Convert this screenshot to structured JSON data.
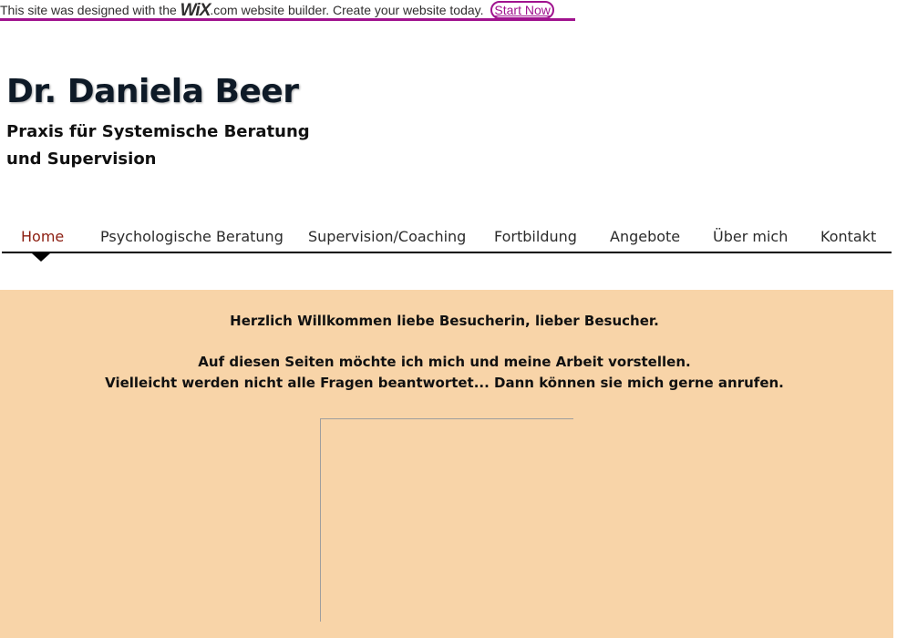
{
  "banner": {
    "prefix": "This site was designed with the",
    "logo": "WiX",
    "suffix": ".com website builder. Create your website today.",
    "cta": "Start Now",
    "accent": "#a0138e"
  },
  "site": {
    "title": "Dr. Daniela Beer",
    "subtitle_line1": "Praxis für Systemische Beratung",
    "subtitle_line2": "und Supervision"
  },
  "nav": {
    "items": [
      {
        "label": "Home",
        "active": true
      },
      {
        "label": "Psychologische Beratung",
        "active": false
      },
      {
        "label": "Supervision/Coaching",
        "active": false
      },
      {
        "label": "Fortbildung",
        "active": false
      },
      {
        "label": "Angebote",
        "active": false
      },
      {
        "label": "Über mich",
        "active": false
      },
      {
        "label": "Kontakt",
        "active": false
      }
    ],
    "active_color": "#8c1d10"
  },
  "content": {
    "background": "#f8d4a8",
    "greeting": "Herzlich Willkommen liebe Besucherin, lieber Besucher.",
    "line2": "Auf diesen Seiten möchte ich mich und meine Arbeit vorstellen.",
    "line3": "Vielleicht werden nicht alle Fragen beantwortet...  Dann können sie mich gerne anrufen."
  }
}
